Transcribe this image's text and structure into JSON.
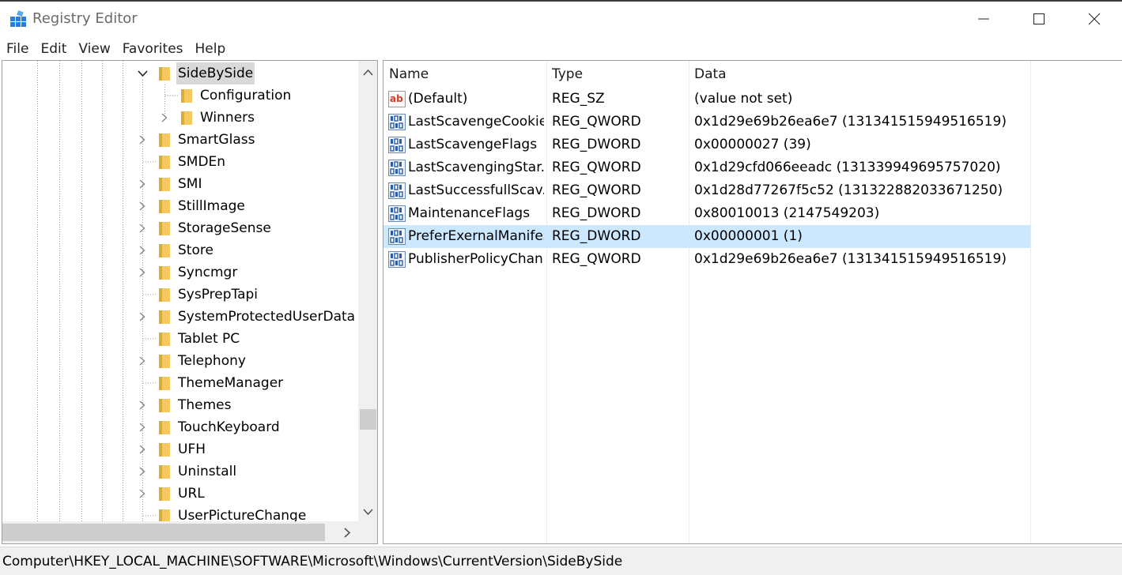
{
  "window": {
    "title": "Registry Editor",
    "icon": "regedit-icon",
    "controls": [
      "minimize-icon",
      "maximize-icon",
      "close-icon"
    ]
  },
  "menu": [
    "File",
    "Edit",
    "View",
    "Favorites",
    "Help"
  ],
  "tree": {
    "items": [
      {
        "label": "SideBySide",
        "expander": "expanded",
        "selected": true
      },
      {
        "label": "Configuration",
        "expander": "none"
      },
      {
        "label": "Winners",
        "expander": "collapsed"
      },
      {
        "label": "SmartGlass",
        "expander": "collapsed"
      },
      {
        "label": "SMDEn",
        "expander": "none"
      },
      {
        "label": "SMI",
        "expander": "collapsed"
      },
      {
        "label": "StillImage",
        "expander": "collapsed"
      },
      {
        "label": "StorageSense",
        "expander": "collapsed"
      },
      {
        "label": "Store",
        "expander": "collapsed"
      },
      {
        "label": "Syncmgr",
        "expander": "collapsed"
      },
      {
        "label": "SysPrepTapi",
        "expander": "none"
      },
      {
        "label": "SystemProtectedUserData",
        "expander": "collapsed"
      },
      {
        "label": "Tablet PC",
        "expander": "none"
      },
      {
        "label": "Telephony",
        "expander": "collapsed"
      },
      {
        "label": "ThemeManager",
        "expander": "none"
      },
      {
        "label": "Themes",
        "expander": "collapsed"
      },
      {
        "label": "TouchKeyboard",
        "expander": "collapsed"
      },
      {
        "label": "UFH",
        "expander": "collapsed"
      },
      {
        "label": "Uninstall",
        "expander": "collapsed"
      },
      {
        "label": "URL",
        "expander": "collapsed"
      },
      {
        "label": "UserPictureChange",
        "expander": "none"
      }
    ]
  },
  "values": {
    "columns": [
      "Name",
      "Type",
      "Data"
    ],
    "rows": [
      {
        "name": "(Default)",
        "type": "REG_SZ",
        "data": "(value not set)",
        "icon": "string-value-icon"
      },
      {
        "name": "LastScavengeCookie",
        "type": "REG_QWORD",
        "data": "0x1d29e69b26ea6e7 (131341515949516519)",
        "icon": "binary-value-icon"
      },
      {
        "name": "LastScavengeFlags",
        "type": "REG_DWORD",
        "data": "0x00000027 (39)",
        "icon": "binary-value-icon"
      },
      {
        "name": "LastScavengingStar...",
        "type": "REG_QWORD",
        "data": "0x1d29cfd066eeadc (131339949695757020)",
        "icon": "binary-value-icon"
      },
      {
        "name": "LastSuccessfullScav...",
        "type": "REG_QWORD",
        "data": "0x1d28d77267f5c52 (131322882033671250)",
        "icon": "binary-value-icon"
      },
      {
        "name": "MaintenanceFlags",
        "type": "REG_DWORD",
        "data": "0x80010013 (2147549203)",
        "icon": "binary-value-icon"
      },
      {
        "name": "PreferExernalManifest",
        "type": "REG_DWORD",
        "data": "0x00000001 (1)",
        "icon": "binary-value-icon",
        "selected": true
      },
      {
        "name": "PublisherPolicyChan...",
        "type": "REG_QWORD",
        "data": "0x1d29e69b26ea6e7 (131341515949516519)",
        "icon": "binary-value-icon"
      }
    ]
  },
  "status": {
    "path": "Computer\\HKEY_LOCAL_MACHINE\\SOFTWARE\\Microsoft\\Windows\\CurrentVersion\\SideBySide"
  },
  "colors": {
    "selection": "#cce8ff",
    "tree_selection": "#d9d9d9",
    "folder": "#f4c95d",
    "folder_dark": "#dcac3a",
    "border": "#a0a0a0"
  }
}
